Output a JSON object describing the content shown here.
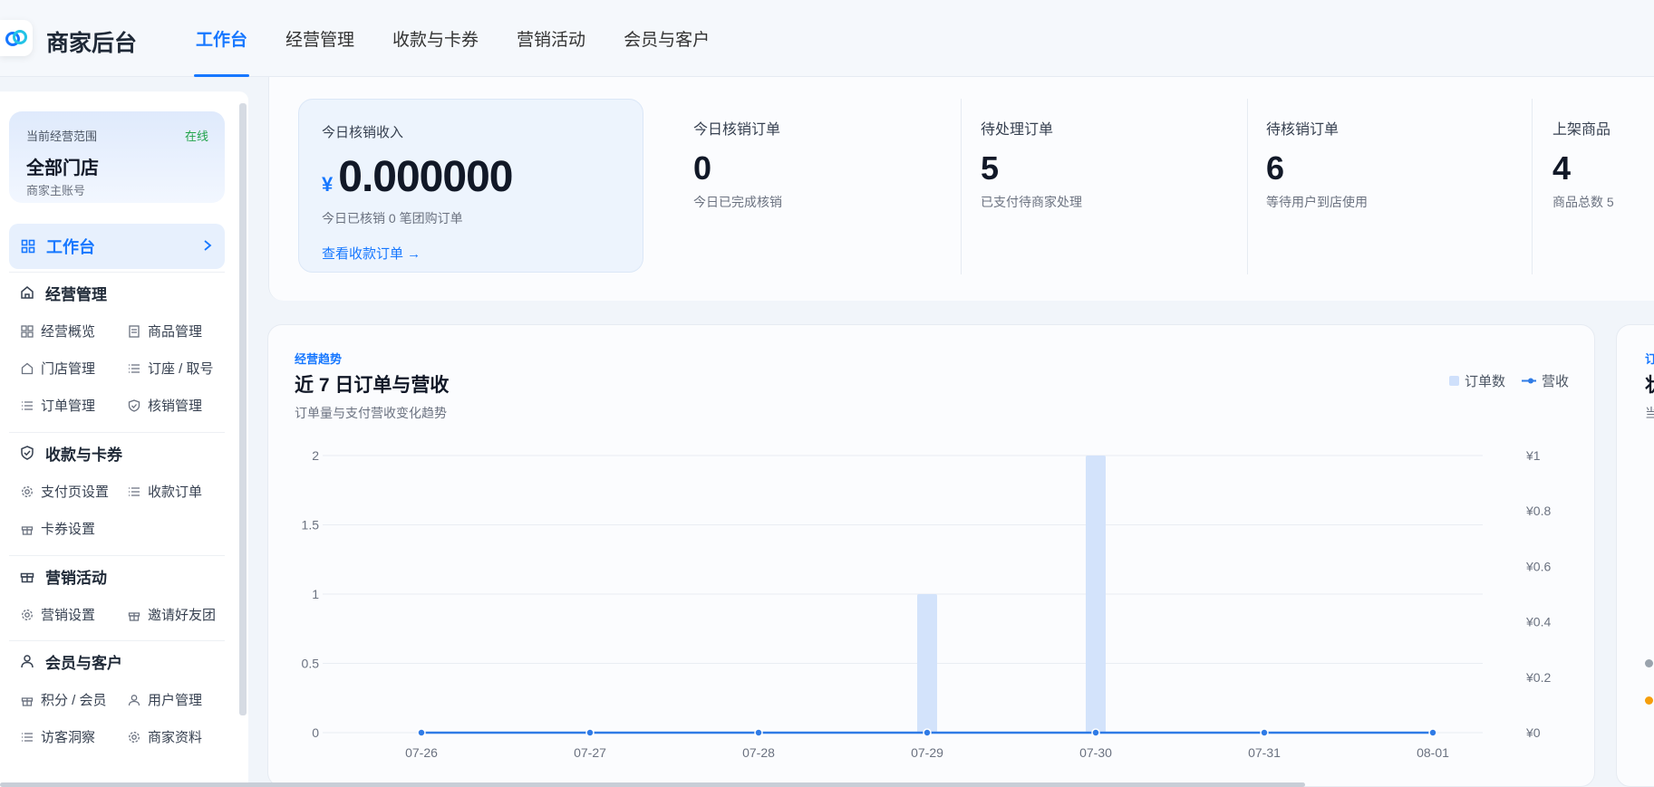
{
  "app": {
    "brand": "商家后台"
  },
  "nav": {
    "items": [
      {
        "label": "工作台",
        "active": true
      },
      {
        "label": "经营管理",
        "active": false
      },
      {
        "label": "收款与卡券",
        "active": false
      },
      {
        "label": "营销活动",
        "active": false
      },
      {
        "label": "会员与客户",
        "active": false
      }
    ]
  },
  "sidebar": {
    "scope_label": "当前经营范围",
    "scope_status": "在线",
    "scope_name": "全部门店",
    "scope_sub": "商家主账号",
    "workbench": "工作台",
    "sections": [
      {
        "title": "经营管理",
        "items": [
          "经营概览",
          "商品管理",
          "门店管理",
          "订座 / 取号",
          "订单管理",
          "核销管理"
        ]
      },
      {
        "title": "收款与卡券",
        "items": [
          "支付页设置",
          "收款订单",
          "卡券设置"
        ]
      },
      {
        "title": "营销活动",
        "items": [
          "营销设置",
          "邀请好友团"
        ]
      },
      {
        "title": "会员与客户",
        "items": [
          "积分 / 会员",
          "用户管理",
          "访客洞察",
          "商家资料"
        ]
      }
    ]
  },
  "kpi": {
    "main": {
      "label": "今日核销收入",
      "currency": "¥",
      "value": "0.000000",
      "note": "今日已核销 0 笔团购订单",
      "link": "查看收款订单 →"
    },
    "stats": [
      {
        "label": "今日核销订单",
        "value": "0",
        "note": "今日已完成核销"
      },
      {
        "label": "待处理订单",
        "value": "5",
        "note": "已支付待商家处理"
      },
      {
        "label": "待核销订单",
        "value": "6",
        "note": "等待用户到店使用"
      },
      {
        "label": "上架商品",
        "value": "4",
        "note": "商品总数 5"
      }
    ]
  },
  "trend": {
    "tag": "经营趋势",
    "title": "近 7 日订单与营收",
    "subtitle": "订单量与支付营收变化趋势",
    "legend_orders": "订单数",
    "legend_revenue": "营收"
  },
  "chart_data": {
    "type": "bar",
    "categories": [
      "07-26",
      "07-27",
      "07-28",
      "07-29",
      "07-30",
      "07-31",
      "08-01"
    ],
    "series": [
      {
        "name": "订单数",
        "type": "bar",
        "axis": "left",
        "values": [
          0,
          0,
          0,
          1,
          2,
          0,
          0
        ]
      },
      {
        "name": "营收",
        "type": "line",
        "axis": "right",
        "values": [
          0,
          0,
          0,
          0,
          0,
          0,
          0
        ]
      }
    ],
    "y_left_ticks": [
      "0",
      "0.5",
      "1",
      "1.5",
      "2"
    ],
    "y_right_ticks": [
      "¥0",
      "¥0.2",
      "¥0.4",
      "¥0.6",
      "¥0.8",
      "¥1"
    ],
    "ylim_left": [
      0,
      2
    ],
    "ylim_right": [
      0,
      1
    ],
    "grid": true,
    "legend_position": "top-right"
  },
  "colors": {
    "accent": "#1677ff",
    "bar": "#d3e3fb",
    "line": "#2f7be6"
  },
  "right_card": {
    "tag": "订",
    "title": "状",
    "sub": "当"
  }
}
